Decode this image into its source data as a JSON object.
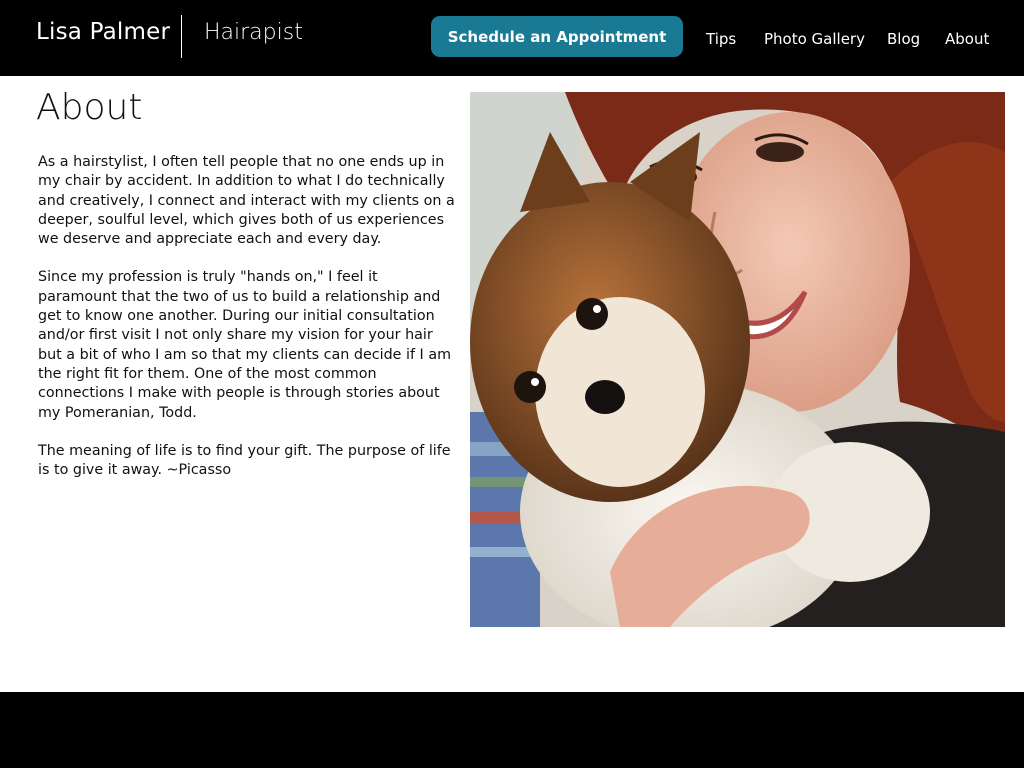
{
  "header": {
    "brand_name": "Lisa Palmer",
    "brand_tagline": "Hairapist",
    "cta_label": "Schedule an Appointment",
    "nav": [
      "Tips",
      "Photo Gallery",
      "Blog",
      "About"
    ]
  },
  "main": {
    "title": "About",
    "paragraphs": [
      "As a hairstylist, I often tell people that no one ends up in my chair by accident.  In addition to what I do technically and creatively,  I connect and interact with my clients on a deeper, soulful level, which gives both of us experiences we deserve and appreciate each and every day.",
      "Since my profession is truly \"hands on,\" I feel it paramount that the two of us to build a relationship and get to know one another.  During our initial consultation and/or first visit  I not only share my vision for your hair but a bit of who I am so that my clients can decide if I am the right fit for them. One of the most common connections I make with people is through stories about my Pomeranian, Todd.",
      "The meaning of life is to find your gift.  The purpose of life is to give it away.  ~Picasso"
    ]
  },
  "colors": {
    "header_bg": "#000000",
    "cta_bg": "#1b7a93",
    "footer_bg": "#000000"
  },
  "photo": {
    "subject": "woman-with-pomeranian-photo"
  }
}
